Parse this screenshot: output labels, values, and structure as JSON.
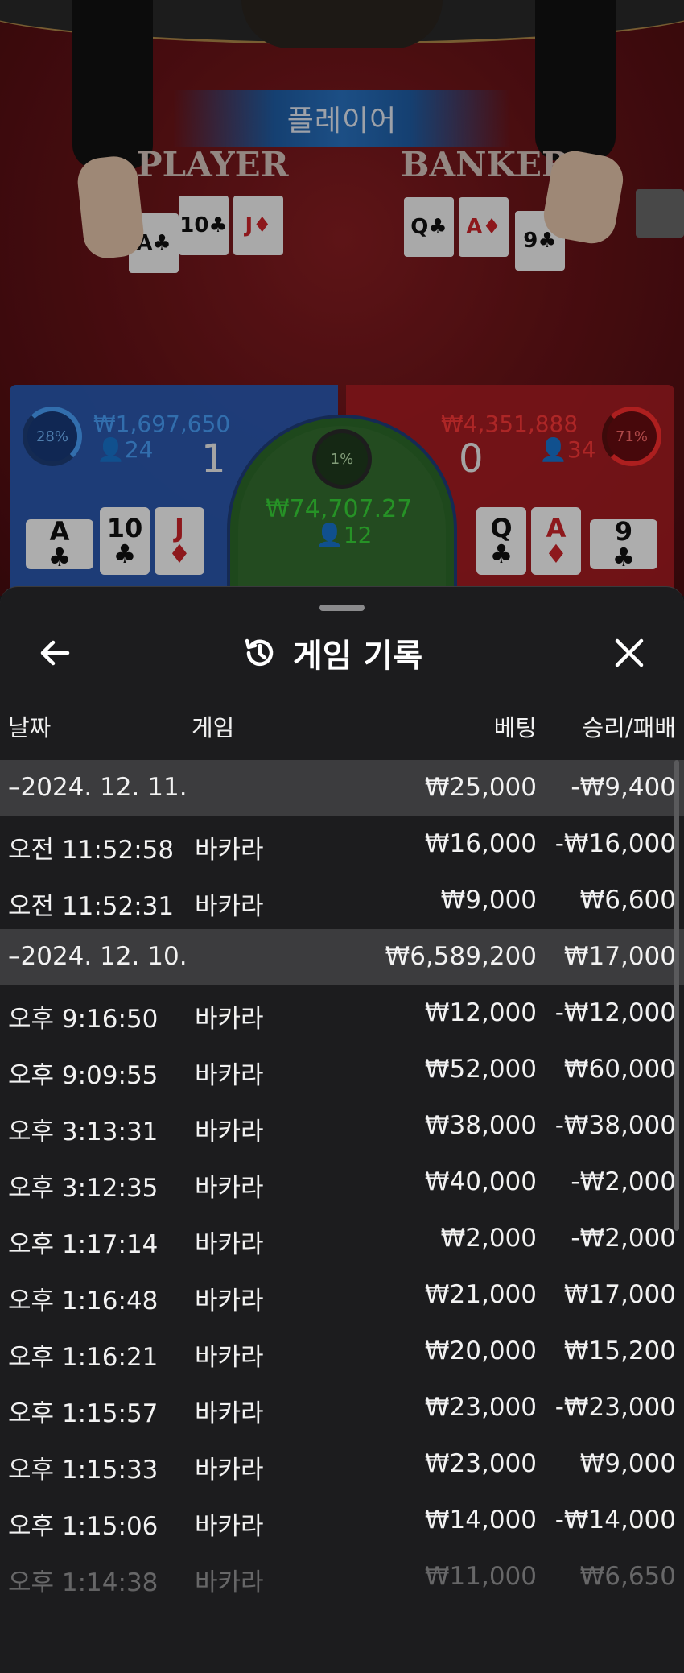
{
  "table": {
    "banner": "플레이어",
    "word_player": "PLAYER",
    "word_banker": "BANKER",
    "cards": [
      {
        "text": "A♣",
        "red": false
      },
      {
        "text": "10♣",
        "red": false
      },
      {
        "text": "J♦",
        "red": true
      },
      {
        "text": "Q♣",
        "red": false
      },
      {
        "text": "A♦",
        "red": true
      },
      {
        "text": "9♣",
        "red": false
      }
    ]
  },
  "bets": {
    "player": {
      "percent": "28%",
      "amount": "₩1,697,650",
      "count": "👤24",
      "score": "1",
      "color": "#4aa3ff"
    },
    "tie": {
      "percent": "1%",
      "amount": "₩74,707.27",
      "count": "👤12",
      "color": "#39d838"
    },
    "banker": {
      "percent": "71%",
      "amount": "₩4,351,888",
      "count": "👤34",
      "score": "0",
      "color": "#ff3838"
    },
    "player_cards": [
      {
        "rank": "A",
        "suit": "♣",
        "red": false
      },
      {
        "rank": "10",
        "suit": "♣",
        "red": false
      },
      {
        "rank": "J",
        "suit": "♦",
        "red": true
      }
    ],
    "banker_cards": [
      {
        "rank": "Q",
        "suit": "♣",
        "red": false
      },
      {
        "rank": "A",
        "suit": "♦",
        "red": true
      },
      {
        "rank": "9",
        "suit": "♣",
        "red": false
      }
    ]
  },
  "history": {
    "title": "게임 기록",
    "icons": {
      "back": "arrow-left-icon",
      "title": "history-icon",
      "close": "close-icon"
    },
    "columns": {
      "date": "날짜",
      "game": "게임",
      "bet": "베팅",
      "win_loss": "승리/패배"
    },
    "rows": [
      {
        "type": "group",
        "date": "–2024. 12. 11.",
        "game": "",
        "bet": "₩25,000",
        "win_loss": "-₩9,400"
      },
      {
        "type": "entry",
        "date": "오전 11:52:58",
        "game": "바카라",
        "bet": "₩16,000",
        "win_loss": "-₩16,000"
      },
      {
        "type": "entry",
        "date": "오전 11:52:31",
        "game": "바카라",
        "bet": "₩9,000",
        "win_loss": "₩6,600"
      },
      {
        "type": "group",
        "date": "–2024. 12. 10.",
        "game": "",
        "bet": "₩6,589,200",
        "win_loss": "₩17,000"
      },
      {
        "type": "entry",
        "date": "오후 9:16:50",
        "game": "바카라",
        "bet": "₩12,000",
        "win_loss": "-₩12,000"
      },
      {
        "type": "entry",
        "date": "오후 9:09:55",
        "game": "바카라",
        "bet": "₩52,000",
        "win_loss": "₩60,000"
      },
      {
        "type": "entry",
        "date": "오후 3:13:31",
        "game": "바카라",
        "bet": "₩38,000",
        "win_loss": "-₩38,000"
      },
      {
        "type": "entry",
        "date": "오후 3:12:35",
        "game": "바카라",
        "bet": "₩40,000",
        "win_loss": "-₩2,000"
      },
      {
        "type": "entry",
        "date": "오후 1:17:14",
        "game": "바카라",
        "bet": "₩2,000",
        "win_loss": "-₩2,000"
      },
      {
        "type": "entry",
        "date": "오후 1:16:48",
        "game": "바카라",
        "bet": "₩21,000",
        "win_loss": "₩17,000"
      },
      {
        "type": "entry",
        "date": "오후 1:16:21",
        "game": "바카라",
        "bet": "₩20,000",
        "win_loss": "₩15,200"
      },
      {
        "type": "entry",
        "date": "오후 1:15:57",
        "game": "바카라",
        "bet": "₩23,000",
        "win_loss": "-₩23,000"
      },
      {
        "type": "entry",
        "date": "오후 1:15:33",
        "game": "바카라",
        "bet": "₩23,000",
        "win_loss": "₩9,000"
      },
      {
        "type": "entry",
        "date": "오후 1:15:06",
        "game": "바카라",
        "bet": "₩14,000",
        "win_loss": "-₩14,000"
      },
      {
        "type": "entry",
        "date": "오후 1:14:38",
        "game": "바카라",
        "bet": "₩11,000",
        "win_loss": "₩6,650",
        "faded": true
      }
    ]
  }
}
